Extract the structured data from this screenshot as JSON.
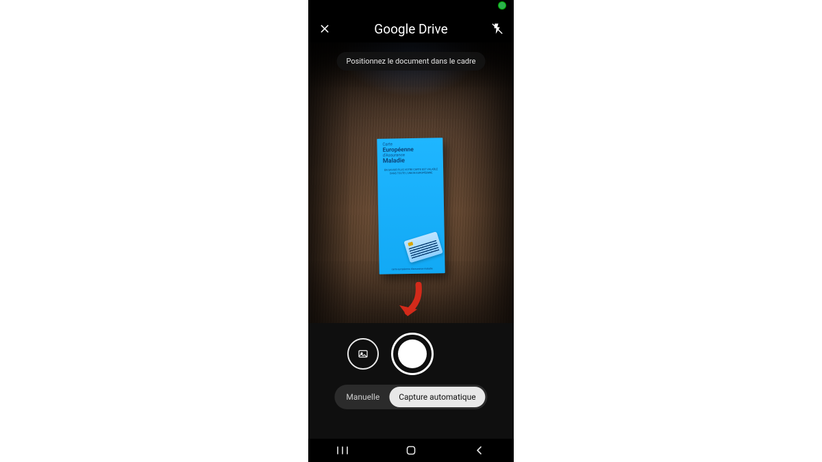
{
  "app": {
    "title": "Google Drive"
  },
  "hint": "Positionnez le document dans le cadre",
  "document": {
    "line1": "Carte",
    "line2": "Européenne",
    "line3": "d'Assurance",
    "line4": "Maladie",
    "tagline": "EN SAVOIR PLUS VOTRE CARTE EST VALABLE DANS TOUTE L'UNION EUROPÉENNE",
    "footer": "carte européenne d'assurance maladie"
  },
  "modes": {
    "manual": "Manuelle",
    "auto": "Capture automatique",
    "active": "auto"
  },
  "icons": {
    "close": "close-icon",
    "flash_off": "flash-off-icon",
    "gallery": "gallery-icon",
    "shutter": "shutter-icon",
    "recents": "nav-recents-icon",
    "home": "nav-home-icon",
    "back": "nav-back-icon"
  },
  "colors": {
    "accent_doc": "#1fb6ff",
    "arrow": "#d32a1a"
  }
}
